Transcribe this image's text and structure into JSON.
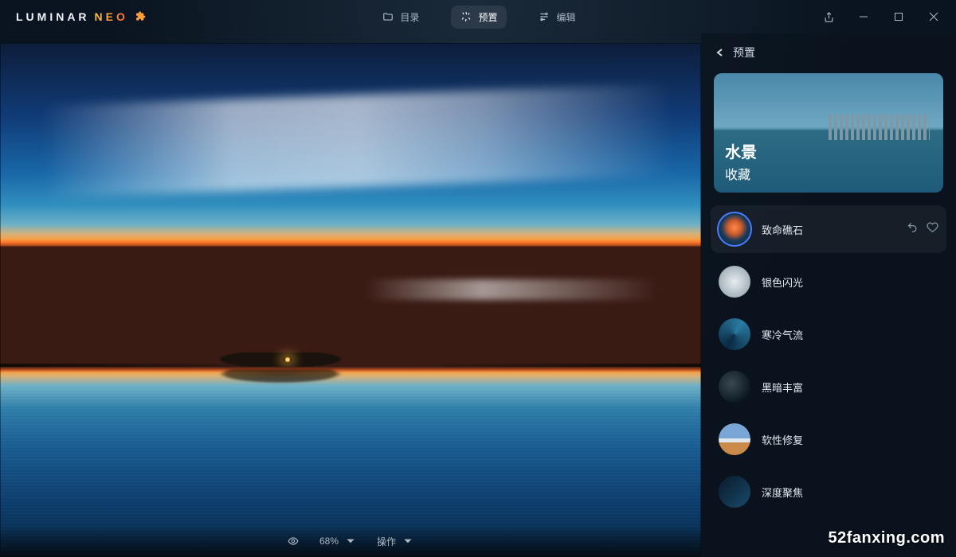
{
  "logo": {
    "luminar": "LUMINAR",
    "neo": "NEO"
  },
  "tabs": {
    "catalog": "目录",
    "presets": "预置",
    "edit": "编辑"
  },
  "window": {
    "share": "share",
    "minimize": "minimize",
    "maximize": "maximize",
    "close": "close"
  },
  "bottombar": {
    "zoom": "68%",
    "actions": "操作"
  },
  "sidebar": {
    "back_label": "预置",
    "collection": {
      "title": "水景",
      "subtitle": "收藏"
    },
    "presets": [
      {
        "label": "致命礁石",
        "thumb": "th-fish",
        "selected": true
      },
      {
        "label": "银色闪光",
        "thumb": "th-silver",
        "selected": false
      },
      {
        "label": "寒冷气流",
        "thumb": "th-cold",
        "selected": false
      },
      {
        "label": "黑暗丰富",
        "thumb": "th-dark",
        "selected": false
      },
      {
        "label": "软性修复",
        "thumb": "th-soft",
        "selected": false
      },
      {
        "label": "深度聚焦",
        "thumb": "th-deep",
        "selected": false
      }
    ]
  },
  "watermark": "52fanxing.com"
}
